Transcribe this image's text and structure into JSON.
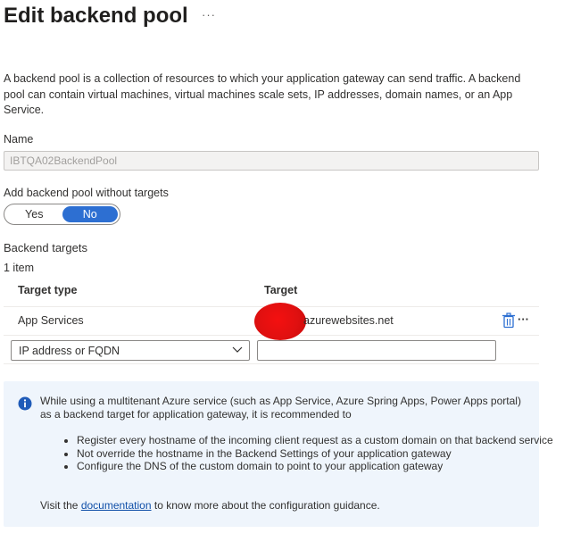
{
  "header": {
    "title": "Edit backend pool",
    "more": "···"
  },
  "description": "A backend pool is a collection of resources to which your application gateway can send traffic. A backend pool can contain virtual machines, virtual machines scale sets, IP addresses, domain names, or an App Service.",
  "name_field": {
    "label": "Name",
    "value": "IBTQA02BackendPool"
  },
  "without_targets": {
    "label": "Add backend pool without targets",
    "options": [
      "Yes",
      "No"
    ],
    "selected": "No"
  },
  "backend_targets": {
    "label": "Backend targets",
    "count_text": "1 item",
    "columns": [
      "Target type",
      "Target"
    ],
    "rows": [
      {
        "type": "App Services",
        "target": "azurewebsites.net",
        "more": "···"
      }
    ],
    "new_row": {
      "type_selected": "IP address or FQDN",
      "target_value": ""
    }
  },
  "info": {
    "text": "While using a multitenant Azure service (such as App Service, Azure Spring Apps, Power Apps portal) as a backend target for application gateway, it is recommended to",
    "bullets": [
      "Register every hostname of the incoming client request as a custom domain on that backend service",
      "Not override the hostname in the Backend Settings of your application gateway",
      "Configure the DNS of the custom domain to point to your application gateway"
    ],
    "visit_prefix": "Visit the",
    "link_text": "documentation",
    "visit_suffix": "to know more about the configuration guidance."
  },
  "colors": {
    "accent": "#2d6fd2",
    "info_bg": "#eff5fc",
    "link": "#0f4fa8",
    "redaction": "#e01010"
  },
  "icons": {
    "trash": "trash-icon",
    "info": "info-icon",
    "chevron": "chevron-down-icon"
  }
}
